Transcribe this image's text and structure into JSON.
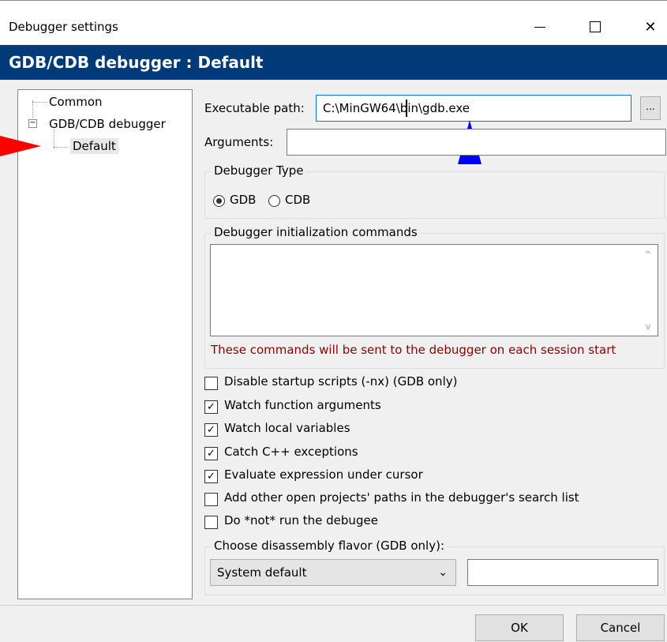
{
  "window": {
    "title": "Debugger settings"
  },
  "banner": {
    "title": "GDB/CDB debugger : Default"
  },
  "tree": {
    "items": [
      {
        "label": "Common"
      },
      {
        "label": "GDB/CDB debugger"
      },
      {
        "label": "Default"
      }
    ]
  },
  "form": {
    "executable_label": "Executable path:",
    "executable_value": "C:\\MinGW64\\bin\\gdb.exe",
    "browse_label": "...",
    "arguments_label": "Arguments:",
    "arguments_value": "",
    "debugger_type_title": "Debugger Type",
    "gdb_label": "GDB",
    "cdb_label": "CDB",
    "init_commands_title": "Debugger initialization commands",
    "init_commands_value": "",
    "init_note": "These commands will be sent to the debugger on each session start",
    "checks": [
      {
        "label": "Disable startup scripts (-nx) (GDB only)",
        "checked": false
      },
      {
        "label": "Watch function arguments",
        "checked": true
      },
      {
        "label": "Watch local variables",
        "checked": true
      },
      {
        "label": "Catch C++ exceptions",
        "checked": true
      },
      {
        "label": "Evaluate expression under cursor",
        "checked": true
      },
      {
        "label": "Add other open projects' paths in the debugger's search list",
        "checked": false
      },
      {
        "label": "Do *not* run the debugee",
        "checked": false
      }
    ],
    "disassembly_title": "Choose disassembly flavor (GDB only):",
    "disassembly_selected": "System default",
    "disassembly_custom_value": ""
  },
  "buttons": {
    "ok": "OK",
    "cancel": "Cancel"
  },
  "colors": {
    "banner": "#003a78",
    "note": "#8b0000",
    "red_arrow": "#ff0000",
    "blue_arrow": "#0000ff"
  },
  "icons": {
    "checkmark": "check-icon",
    "expand": "minus-box-icon",
    "dropdown": "chevron-down-icon"
  }
}
